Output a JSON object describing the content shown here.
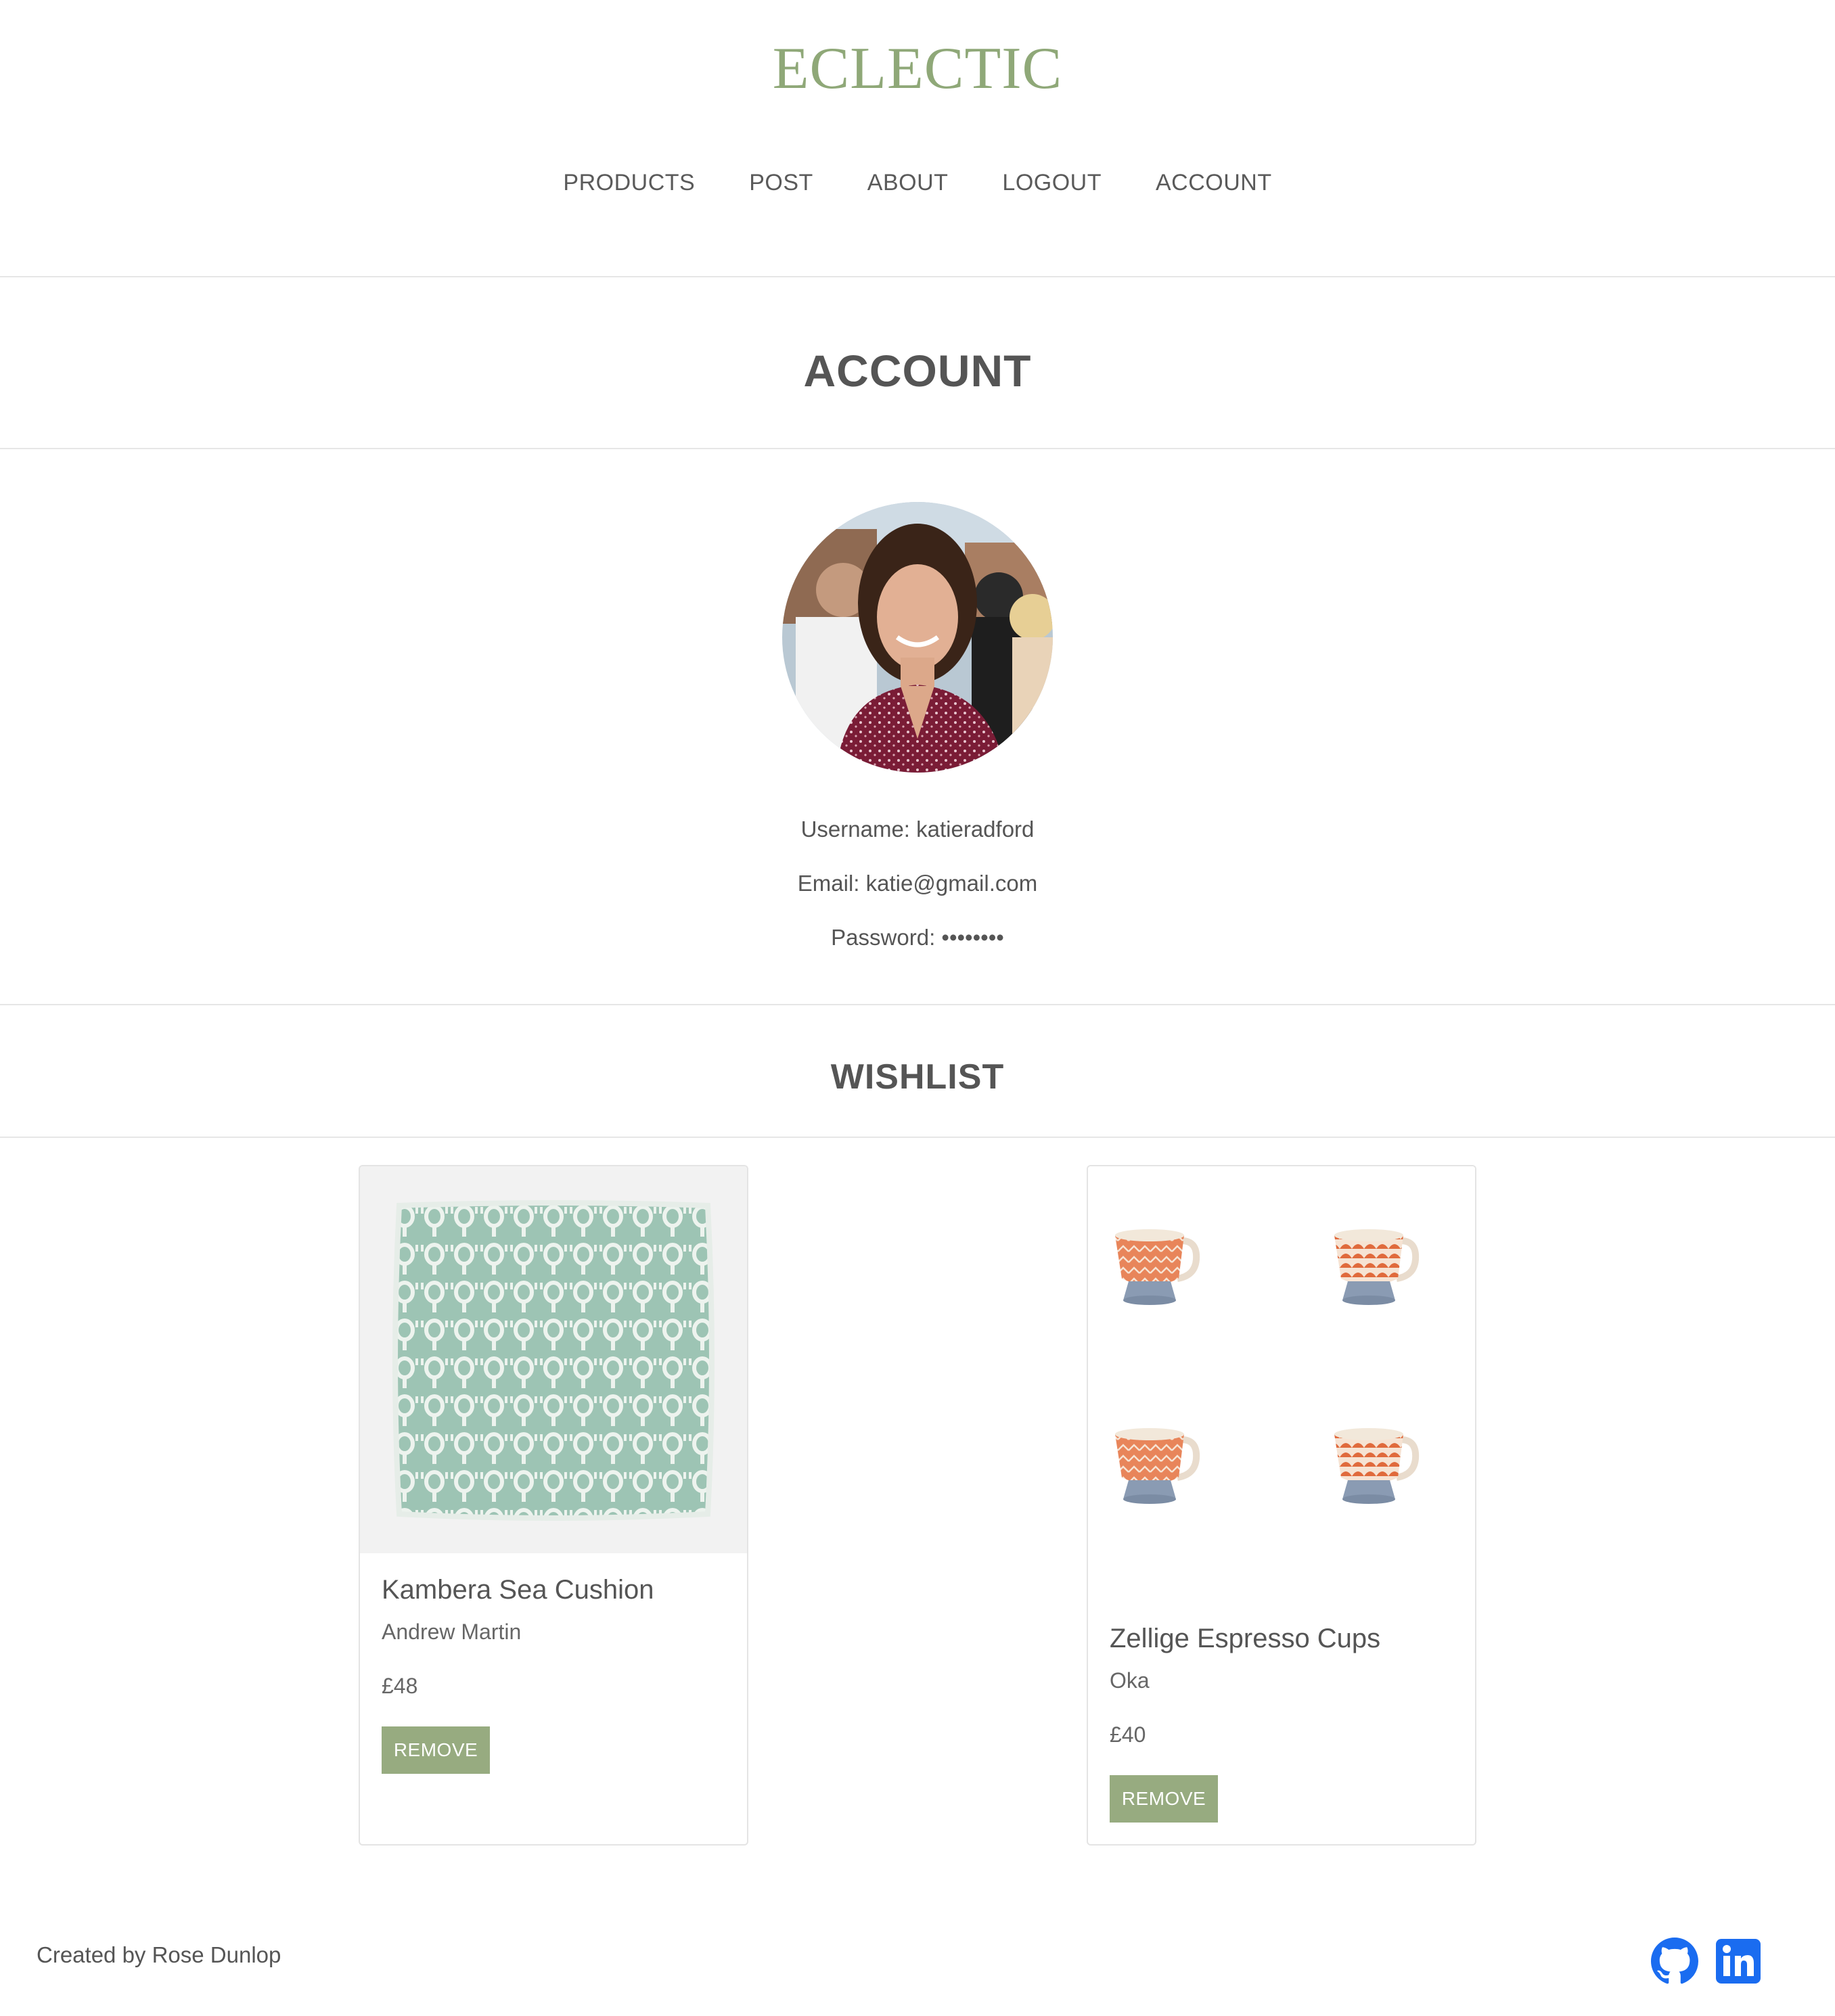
{
  "header": {
    "brand": "ECLECTIC",
    "nav": [
      "PRODUCTS",
      "POST",
      "ABOUT",
      "LOGOUT",
      "ACCOUNT"
    ]
  },
  "account": {
    "title": "ACCOUNT",
    "username_label": "Username: katieradford",
    "email_label": "Email: katie@gmail.com",
    "password_label": "Password: ••••••••"
  },
  "wishlist": {
    "title": "WISHLIST",
    "items": [
      {
        "name": "Kambera Sea Cushion",
        "brand": "Andrew Martin",
        "price": "£48",
        "button": "REMOVE"
      },
      {
        "name": "Zellige Espresso Cups",
        "brand": "Oka",
        "price": "£40",
        "button": "REMOVE"
      }
    ]
  },
  "footer": {
    "credit": "Created by Rose Dunlop",
    "icons": [
      "github-icon",
      "linkedin-icon"
    ]
  },
  "colors": {
    "brand": "#8fa878",
    "button": "#97ab80",
    "social": "#1a6cf0"
  }
}
